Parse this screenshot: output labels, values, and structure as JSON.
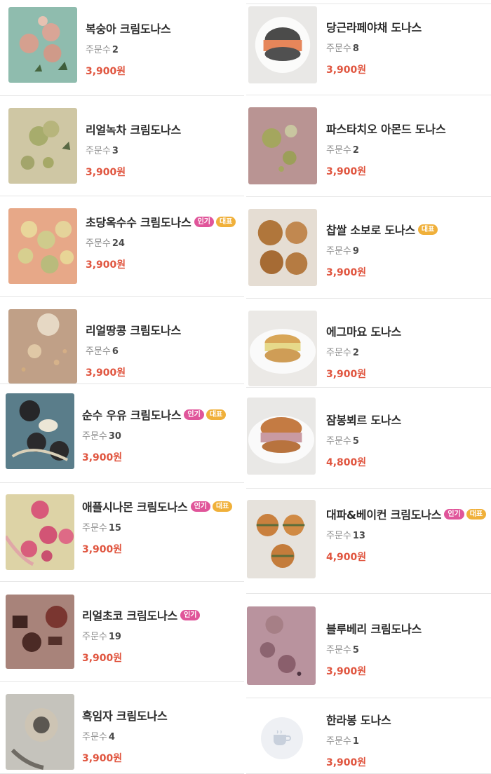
{
  "orders_label": "주문수",
  "badges": {
    "popular": "인기",
    "representative": "대표"
  },
  "left": [
    {
      "name": "복숭아 크림도나스",
      "orders": "2",
      "price": "3,900원",
      "popular": false,
      "rep": false
    },
    {
      "name": "리얼녹차 크림도나스",
      "orders": "3",
      "price": "3,900원",
      "popular": false,
      "rep": false
    },
    {
      "name": "초당옥수수 크림도나스",
      "orders": "24",
      "price": "3,900원",
      "popular": true,
      "rep": true
    },
    {
      "name": "리얼땅콩 크림도나스",
      "orders": "6",
      "price": "3,900원",
      "popular": false,
      "rep": false
    },
    {
      "name": "순수 우유 크림도나스",
      "orders": "30",
      "price": "3,900원",
      "popular": true,
      "rep": true
    },
    {
      "name": "애플시나몬 크림도나스",
      "orders": "15",
      "price": "3,900원",
      "popular": true,
      "rep": true
    },
    {
      "name": "리얼초코 크림도나스",
      "orders": "19",
      "price": "3,900원",
      "popular": true,
      "rep": false
    },
    {
      "name": "흑임자 크림도나스",
      "orders": "4",
      "price": "3,900원",
      "popular": false,
      "rep": false
    }
  ],
  "right": [
    {
      "name": "당근라페야채 도나스",
      "orders": "8",
      "price": "3,900원",
      "popular": false,
      "rep": false
    },
    {
      "name": "파스타치오 아몬드 도나스",
      "orders": "2",
      "price": "3,900원",
      "popular": false,
      "rep": false
    },
    {
      "name": "찹쌀 소보로 도나스",
      "orders": "9",
      "price": "3,900원",
      "popular": false,
      "rep": true
    },
    {
      "name": "에그마요 도나스",
      "orders": "2",
      "price": "3,900원",
      "popular": false,
      "rep": false
    },
    {
      "name": "잠봉뵈르 도나스",
      "orders": "5",
      "price": "4,800원",
      "popular": false,
      "rep": false
    },
    {
      "name": "대파&베이컨 크림도나스",
      "orders": "13",
      "price": "4,900원",
      "popular": true,
      "rep": true
    },
    {
      "name": "블루베리 크림도나스",
      "orders": "5",
      "price": "3,900원",
      "popular": false,
      "rep": false
    },
    {
      "name": "한라봉 도나스",
      "orders": "1",
      "price": "3,900원",
      "popular": false,
      "rep": false
    }
  ],
  "colors": {
    "price": "#e0553f",
    "popular_badge": "#e0559a",
    "representative_badge": "#f0b03a"
  },
  "icons": {
    "no_image": "coffee-cup-icon"
  }
}
